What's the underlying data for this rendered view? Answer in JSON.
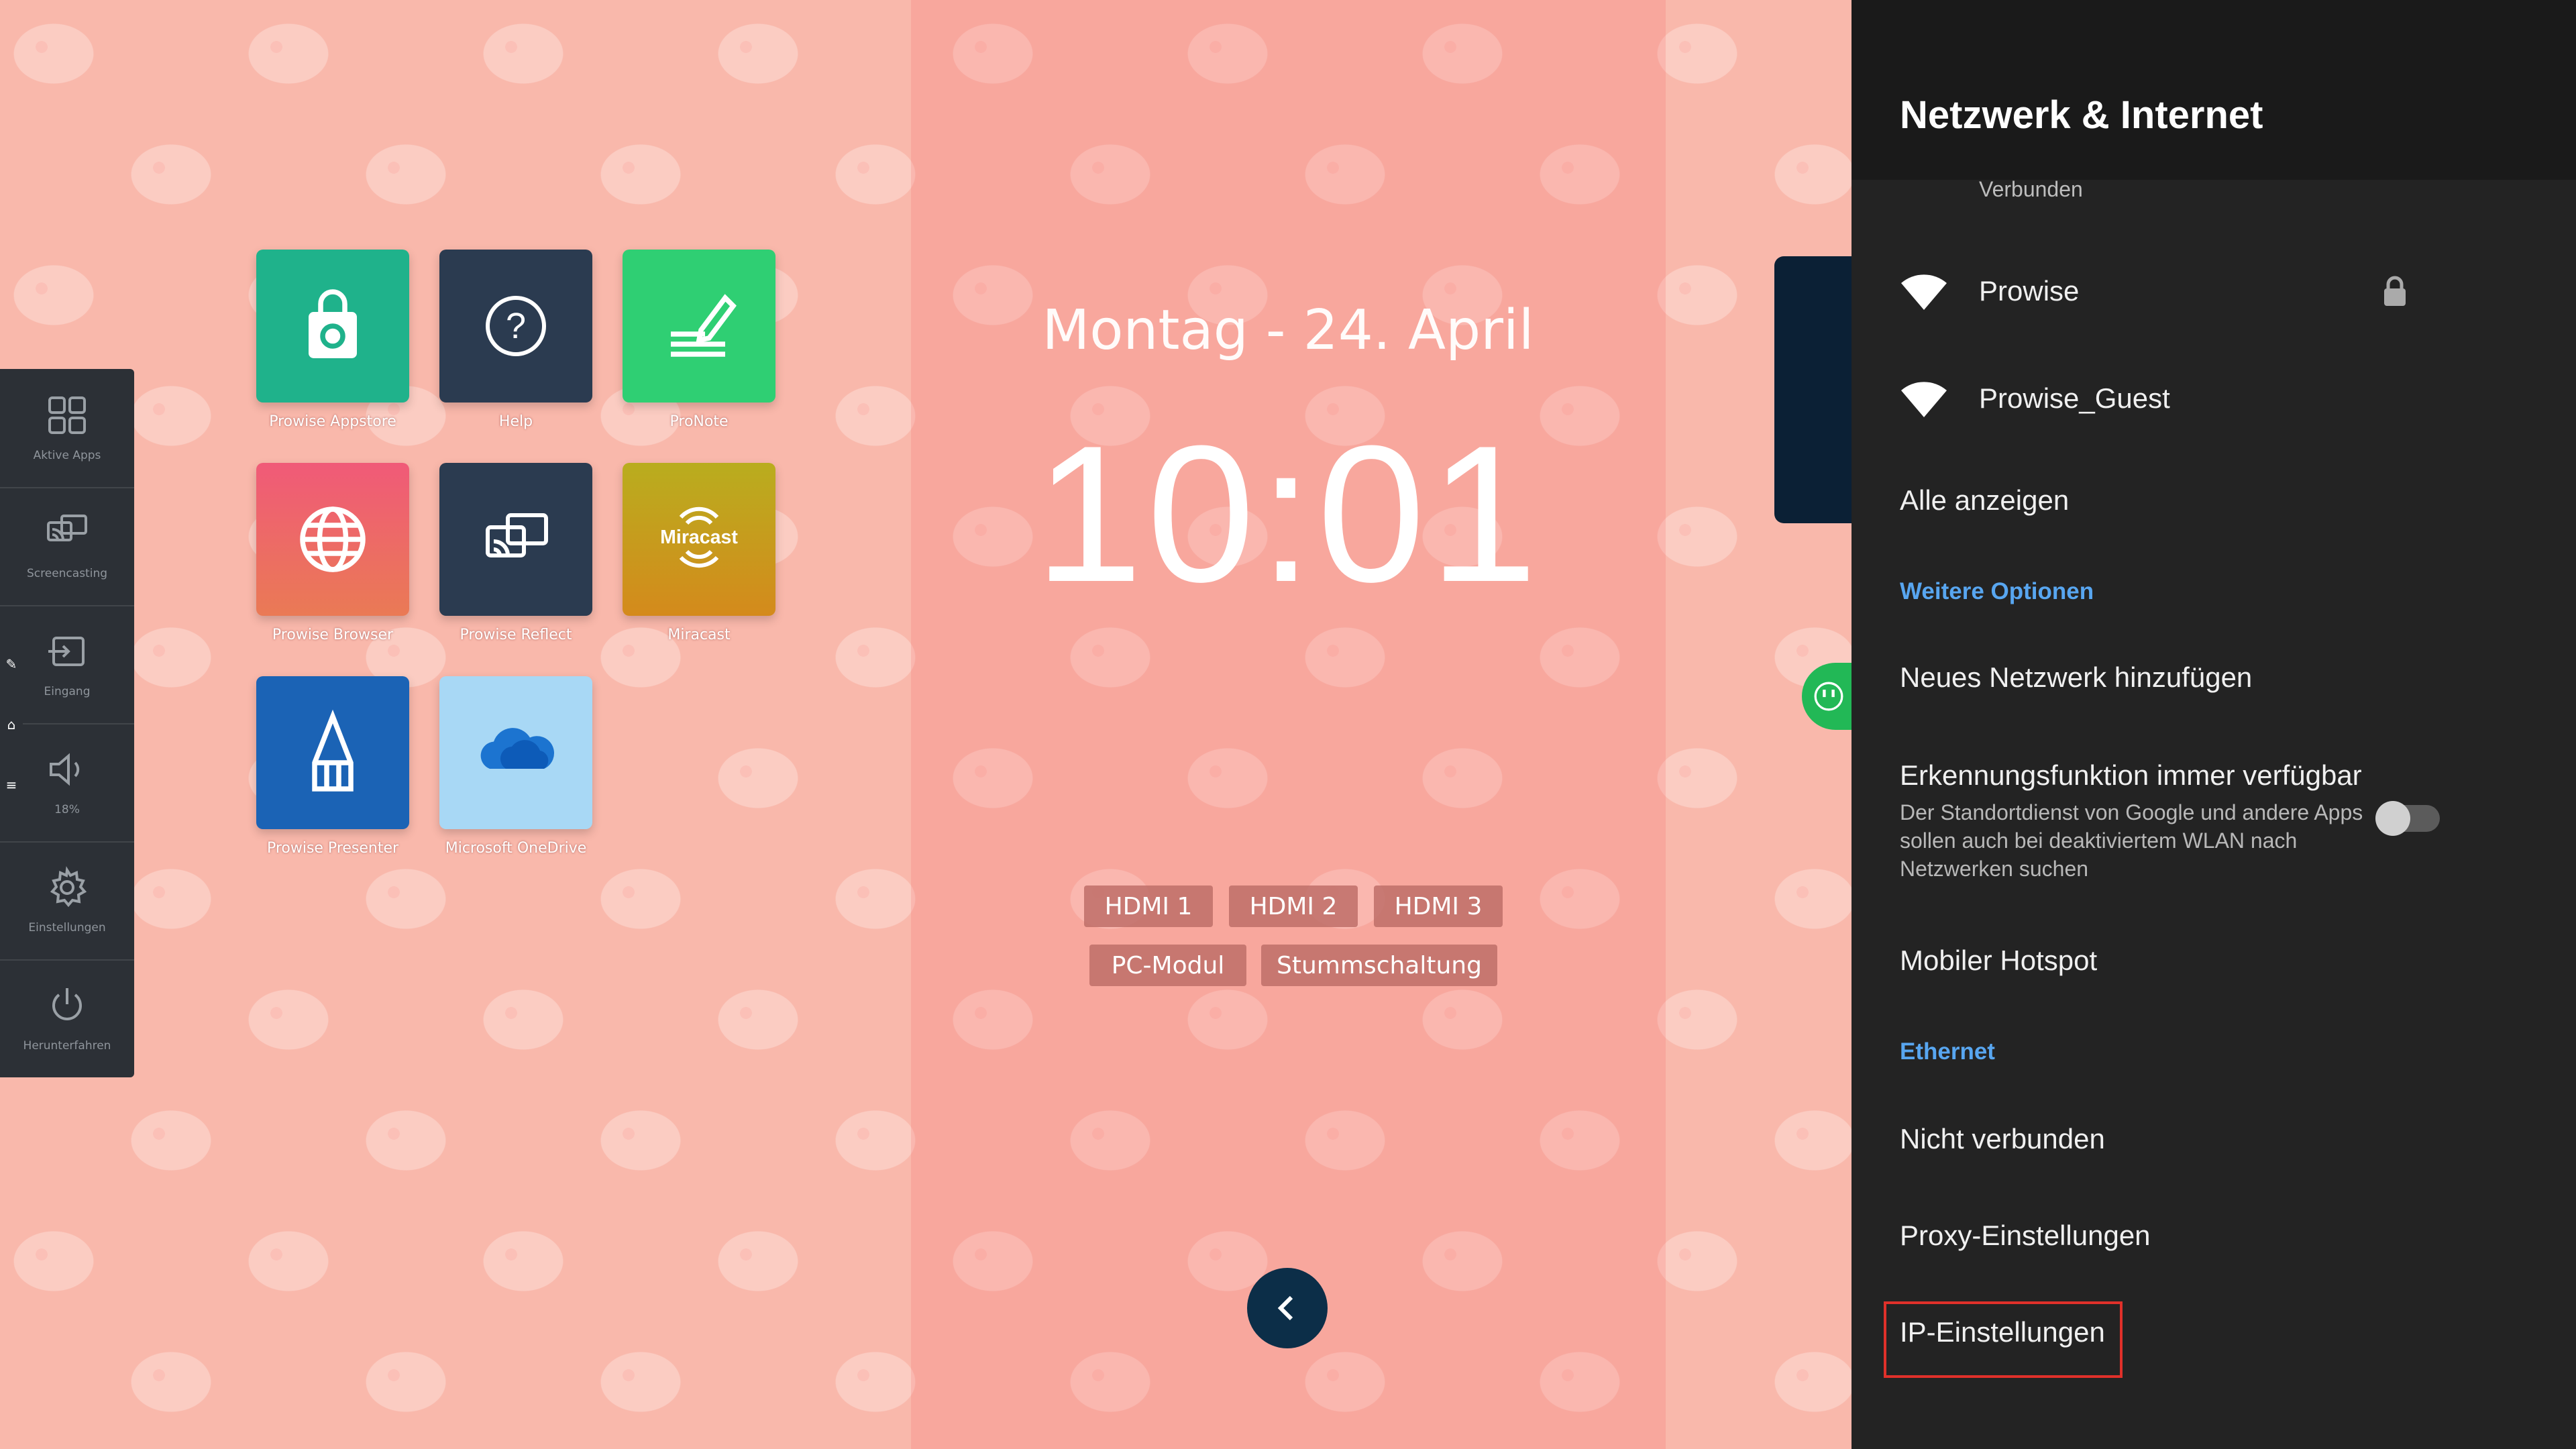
{
  "desktop": {
    "date": "Montag - 24. April",
    "time": "10:01",
    "sources": [
      "HDMI 1",
      "HDMI 2",
      "HDMI 3",
      "PC-Modul",
      "Stummschaltung"
    ]
  },
  "dock": {
    "items": [
      {
        "label": "Aktive Apps",
        "icon": "active-apps-icon"
      },
      {
        "label": "Screencasting",
        "icon": "screencast-icon"
      },
      {
        "label": "Eingang",
        "icon": "input-icon"
      },
      {
        "label": "18%",
        "icon": "volume-icon"
      },
      {
        "label": "Einstellungen",
        "icon": "gear-icon"
      },
      {
        "label": "Herunterfahren",
        "icon": "power-icon"
      }
    ]
  },
  "apps": [
    {
      "label": "Prowise Appstore",
      "color": "#1fb28b"
    },
    {
      "label": "Help",
      "color": "#2b3b50"
    },
    {
      "label": "ProNote",
      "color": "#2fcf73"
    },
    {
      "label": "Prowise Browser",
      "color": "#ee6a74"
    },
    {
      "label": "Prowise Reflect",
      "color": "#2b3b50"
    },
    {
      "label": "Miracast",
      "color": "#b8ab20"
    },
    {
      "label": "Prowise Presenter",
      "color": "#1b63b5"
    },
    {
      "label": "Microsoft OneDrive",
      "color": "#a8d8f5"
    }
  ],
  "miracast_logo_text": "Miracast",
  "panel": {
    "title": "Netzwerk & Internet",
    "connected_partial": "Verbunden",
    "networks": [
      {
        "name": "Prowise",
        "locked": true
      },
      {
        "name": "Prowise_Guest",
        "locked": false
      }
    ],
    "show_all": "Alle anzeigen",
    "more_options": "Weitere Optionen",
    "add_network": "Neues Netzwerk hinzufügen",
    "scan_title": "Erkennungsfunktion immer verfügbar",
    "scan_desc": "Der Standortdienst von Google und andere Apps sollen auch bei deaktiviertem WLAN nach Netzwerken suchen",
    "scan_enabled": false,
    "hotspot": "Mobiler Hotspot",
    "ethernet": "Ethernet",
    "ethernet_status": "Nicht verbunden",
    "proxy": "Proxy-Einstellungen",
    "ip": "IP-Einstellungen"
  },
  "colors": {
    "accent": "#58a6f0",
    "highlight": "#e0302a"
  }
}
